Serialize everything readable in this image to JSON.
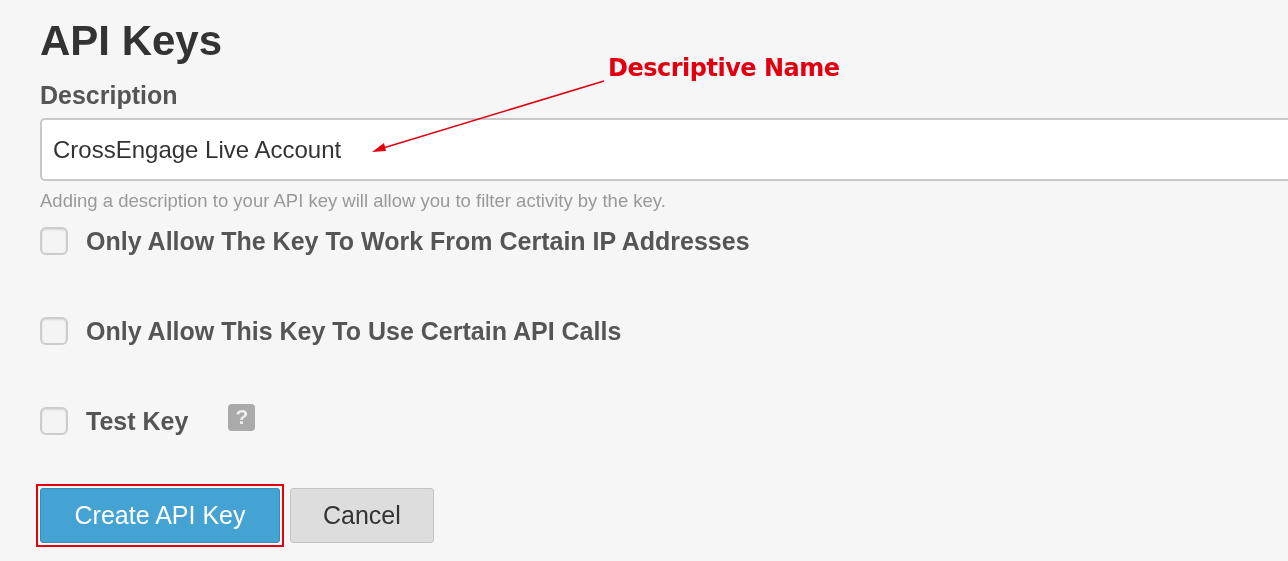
{
  "title": "API Keys",
  "description": {
    "label": "Description",
    "value": "CrossEngage Live Account",
    "help": "Adding a description to your API key will allow you to filter activity by the key."
  },
  "options": [
    {
      "label": "Only Allow The Key To Work From Certain IP Addresses",
      "checked": false
    },
    {
      "label": "Only Allow This Key To Use Certain API Calls",
      "checked": false
    },
    {
      "label": "Test Key",
      "checked": false,
      "help": "?"
    }
  ],
  "buttons": [
    {
      "label": "Create API Key",
      "kind": "primary",
      "highlighted": true
    },
    {
      "label": "Cancel",
      "kind": "secondary",
      "highlighted": false
    }
  ],
  "annotation": {
    "text": "Descriptive Name"
  }
}
